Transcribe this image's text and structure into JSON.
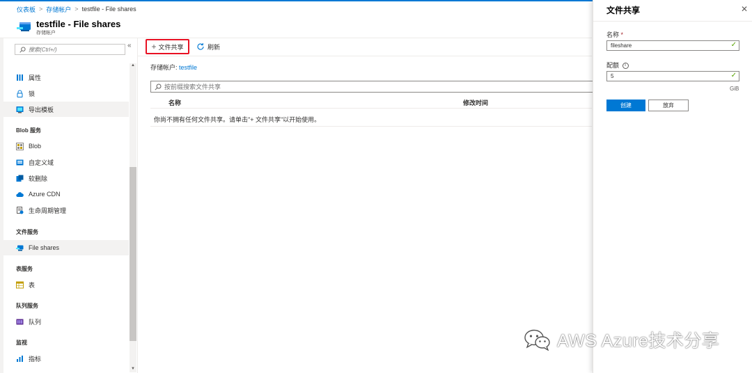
{
  "breadcrumb": {
    "items": [
      "仪表板",
      "存储帐户",
      "testfile - File shares"
    ]
  },
  "header": {
    "title": "testfile - File shares",
    "subtitle": "存储帐户"
  },
  "sidebar": {
    "search_placeholder": "搜索(Ctrl+/)",
    "collapse": "«",
    "items_top": [
      {
        "label": "属性",
        "icon": "properties-icon"
      },
      {
        "label": "锁",
        "icon": "lock-icon"
      },
      {
        "label": "导出模板",
        "icon": "export-template-icon"
      }
    ],
    "sections": {
      "blob": "Blob 服务",
      "file": "文件服务",
      "table": "表服务",
      "queue": "队列服务",
      "monitor": "监视"
    },
    "blob_items": [
      {
        "label": "Blob",
        "icon": "blob-icon"
      },
      {
        "label": "自定义域",
        "icon": "custom-domain-icon"
      },
      {
        "label": "软删除",
        "icon": "soft-delete-icon"
      },
      {
        "label": "Azure CDN",
        "icon": "cloud-icon"
      },
      {
        "label": "生命周期管理",
        "icon": "lifecycle-icon"
      }
    ],
    "file_items": [
      {
        "label": "File shares",
        "icon": "file-share-icon",
        "selected": true
      }
    ],
    "table_items": [
      {
        "label": "表",
        "icon": "table-icon"
      }
    ],
    "queue_items": [
      {
        "label": "队列",
        "icon": "queue-icon"
      }
    ],
    "monitor_items": [
      {
        "label": "指标",
        "icon": "metrics-icon"
      }
    ]
  },
  "toolbar": {
    "add_label": "文件共享",
    "refresh_label": "刷新"
  },
  "main": {
    "storage_label": "存储帐户: ",
    "storage_link": "testfile",
    "search_placeholder": "按前缀搜索文件共享",
    "columns": [
      "名称",
      "修改时间"
    ],
    "empty_message": "你尚不拥有任何文件共享。请单击\"+ 文件共享\"以开始使用。"
  },
  "panel": {
    "title": "文件共享",
    "name_label": "名称",
    "name_required": "*",
    "name_value": "fileshare",
    "quota_label": "配额",
    "quota_value": "5",
    "quota_unit": "GiB",
    "create_label": "创建",
    "cancel_label": "放弃"
  },
  "watermark": {
    "text": "AWS Azure技术分享"
  },
  "colors": {
    "accent": "#0078d4",
    "highlight": "#e81123",
    "valid": "#57a300"
  }
}
